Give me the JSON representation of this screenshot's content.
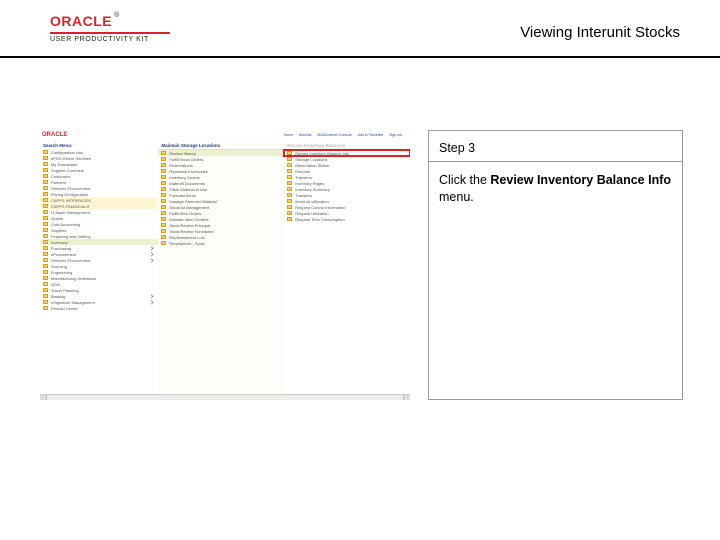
{
  "header": {
    "brand": "ORACLE",
    "tm": "®",
    "subbrand": "USER PRODUCTIVITY KIT",
    "title": "Viewing Interunit Stocks"
  },
  "panel": {
    "step": "Step 3",
    "instr_prefix": "Click the ",
    "instr_bold": "Review Inventory Balance Info",
    "instr_suffix": " menu."
  },
  "mini": {
    "oracle": "ORACLE",
    "tabs": [
      "Home",
      "Worklist",
      "MultiChannel Console",
      "Add to Favorites",
      "Sign out"
    ],
    "search_label": "Search Menu:",
    "colA_top": [
      "Configuration Link",
      "ePOS Online Services",
      "My Downloads",
      "Supplier Contracts",
      "Customers",
      "Partners",
      "Services Procurement",
      "Pricing Configuration"
    ],
    "colA_hl1": [
      "CAPPS INTERFACES",
      "CAPPS FINANCIALS"
    ],
    "colA_mid": [
      "IT Asset Management",
      "Grants",
      "Cost Accounting",
      "Supplies",
      "Financing and Settling"
    ],
    "colA_hl2": "Inventory",
    "colA_bottom": [
      "Purchasing",
      "eProcurement",
      "Services Procurement",
      "Sourcing",
      "Engineering",
      "Manufacturing Definitions",
      "SCM",
      "Travel Planning",
      "Banking",
      "eSignature Management",
      "Product Center"
    ],
    "colB_head": "Maintain Storage Locations",
    "colB_hl": "Review History",
    "colB_items": [
      "Fulfill Stock Orders",
      "Reservations",
      "Replenish Inventories",
      "Inventory Counts",
      "Material Documents",
      "Track Material in Use",
      "Forecast Items",
      "Manage Returned Material",
      "Stockout Management",
      "Fulfill Web Orders",
      "Maintain Item Centers",
      "Stock/Review Principal",
      "Stock/Review Scheduled",
      "Replenishment Lots",
      "Requisitions - Cycle"
    ],
    "colC_head_pale": "Review Inventory Balances",
    "colC_hl3": "Review Inventory Balance Info",
    "colC_items": [
      "Storage Locations",
      "Reservation Status",
      "Records",
      "Transfers",
      "Inventory Pages",
      "Inventory Summary",
      "Transfers",
      "Item/List Utilization",
      "Request Control Information",
      "Request Utilization",
      "Request Time Consumption"
    ]
  }
}
